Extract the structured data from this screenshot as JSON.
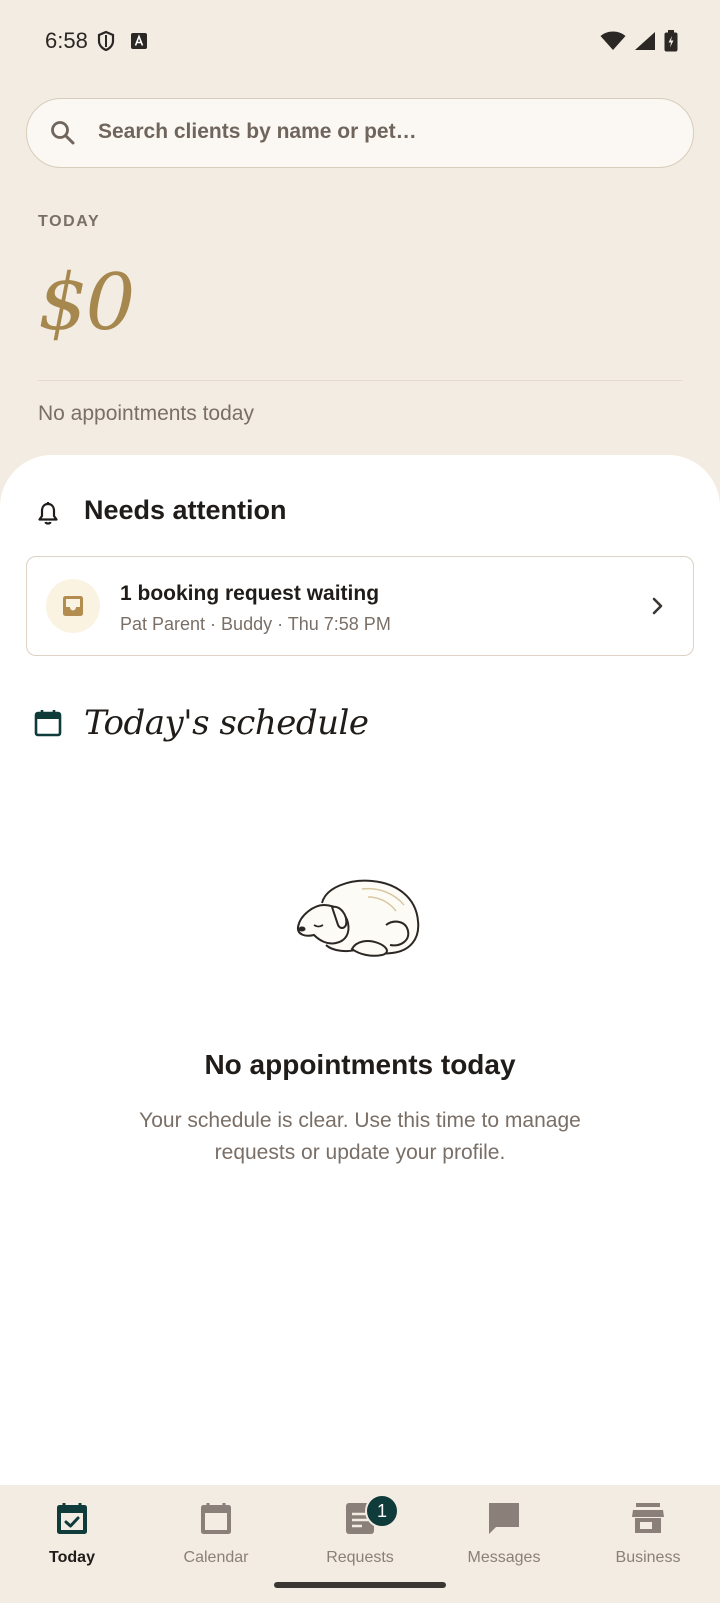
{
  "status_bar": {
    "time": "6:58"
  },
  "search": {
    "placeholder": "Search clients by name or pet…"
  },
  "summary": {
    "section_label": "TODAY",
    "amount": "$0",
    "subtext": "No appointments today"
  },
  "attention": {
    "title": "Needs attention",
    "card": {
      "title": "1 booking request waiting",
      "subtitle": "Pat Parent · Buddy · Thu 7:58 PM"
    }
  },
  "schedule": {
    "title": "Today's schedule",
    "empty_title": "No appointments today",
    "empty_message": "Your schedule is clear. Use this time to manage requests or update your profile."
  },
  "nav": {
    "items": [
      {
        "label": "Today",
        "icon": "calendar-check-icon",
        "active": true
      },
      {
        "label": "Calendar",
        "icon": "calendar-icon",
        "active": false
      },
      {
        "label": "Requests",
        "icon": "document-icon",
        "active": false,
        "badge": "1"
      },
      {
        "label": "Messages",
        "icon": "chat-bubble-icon",
        "active": false
      },
      {
        "label": "Business",
        "icon": "storefront-icon",
        "active": false
      }
    ]
  },
  "colors": {
    "background": "#f3ece2",
    "accent_gold": "#a6884f",
    "badge": "#0f3b3a",
    "text_primary": "#201c19",
    "text_muted": "#7a6f66"
  }
}
